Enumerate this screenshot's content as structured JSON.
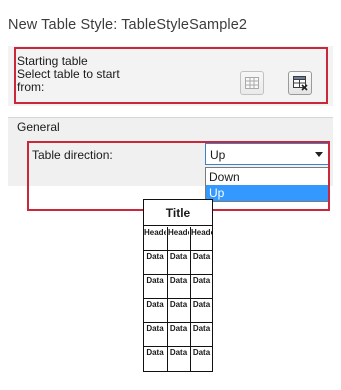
{
  "dialog": {
    "title": "New Table Style: TableStyleSample2"
  },
  "starting_table": {
    "heading": "Starting table",
    "instruction_line1": "Select table to start",
    "instruction_line2": "from:",
    "select_table_button_icon": "select-table-icon",
    "remove_table_button_icon": "remove-table-icon"
  },
  "general": {
    "heading": "General",
    "table_direction_label": "Table direction:",
    "table_direction_value": "Up",
    "table_direction_options": [
      "Down",
      "Up"
    ],
    "highlighted_option": "Up"
  },
  "preview": {
    "title": "Title",
    "header_cell": "Header",
    "data_cell": "Data",
    "header_rows": 1,
    "data_rows": 5,
    "columns": 3
  },
  "colors": {
    "highlight_border": "#c8283a",
    "selected_option_bg": "#3399ff",
    "select_border": "#3a83c9"
  }
}
